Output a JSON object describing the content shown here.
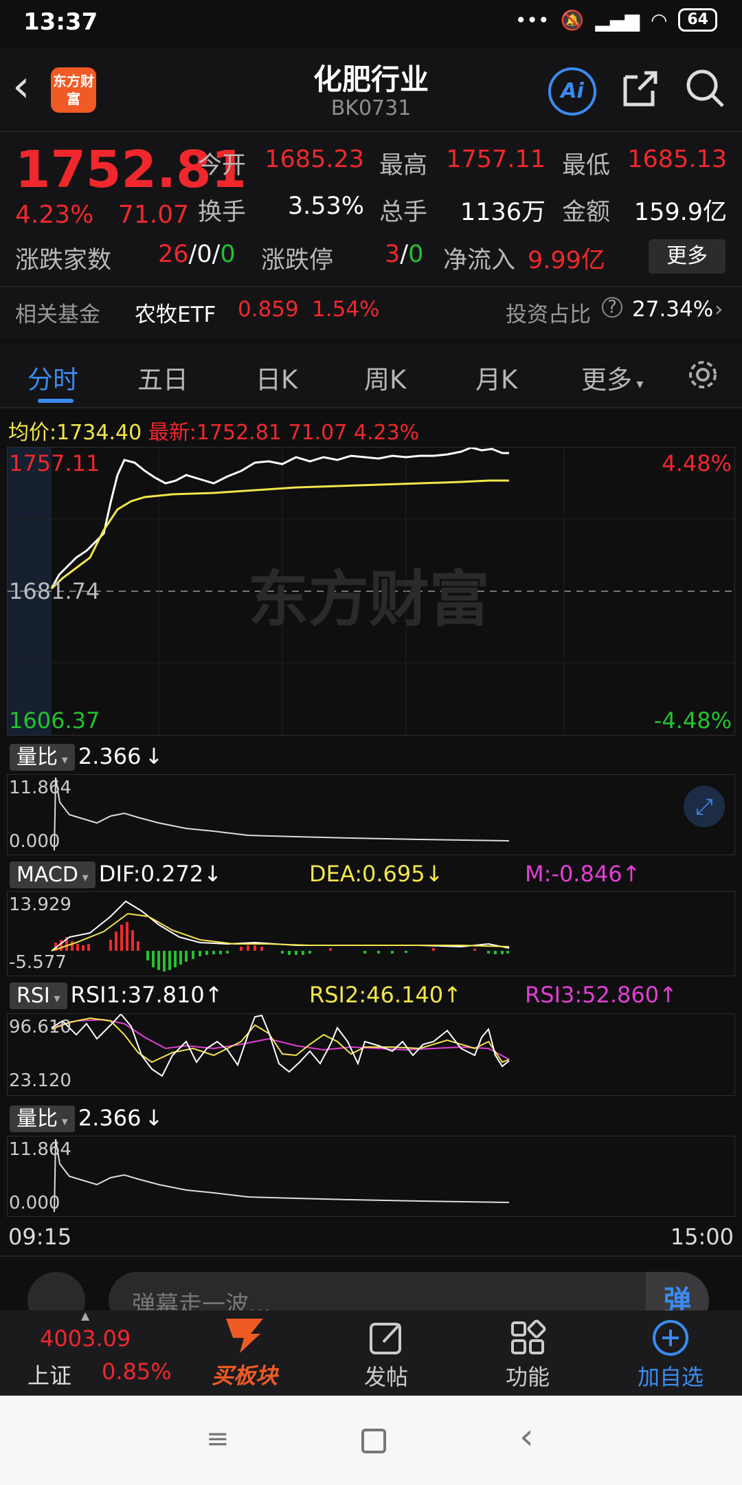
{
  "status": {
    "time": "13:37",
    "battery": "64"
  },
  "header": {
    "title": "化肥行业",
    "code": "BK0731",
    "ai_label": "Ai",
    "logo_text": "东方财富"
  },
  "quote": {
    "price": "1752.81",
    "pct": "4.23%",
    "chg": "71.07",
    "open_label": "今开",
    "open": "1685.23",
    "high_label": "最高",
    "high": "1757.11",
    "low_label": "最低",
    "low": "1685.13",
    "turnover_label": "换手",
    "turnover": "3.53%",
    "volume_label": "总手",
    "volume": "1136万",
    "amount_label": "金额",
    "amount": "159.9亿",
    "updown_label": "涨跌家数",
    "up": "26",
    "flat": "0",
    "down": "0",
    "limit_label": "涨跌停",
    "limit_up": "3",
    "limit_down": "0",
    "inflow_label": "净流入",
    "inflow": "9.99亿",
    "more": "更多"
  },
  "fund": {
    "label": "相关基金",
    "name": "农牧ETF",
    "price": "0.859",
    "pct": "1.54%",
    "ratio_label": "投资占比",
    "ratio": "27.34%"
  },
  "tabs": [
    "分时",
    "五日",
    "日K",
    "周K",
    "月K",
    "更多"
  ],
  "info": {
    "avg_label": "均价:",
    "avg": "1734.40",
    "latest_label": "最新:",
    "latest": "1752.81",
    "chg": "71.07",
    "pct": "4.23%"
  },
  "main_chart": {
    "top": "1757.11",
    "mid": "1681.74",
    "bottom": "1606.37",
    "top_pct": "4.48%",
    "bottom_pct": "-4.48%",
    "watermark": "东方财富"
  },
  "lb1": {
    "name": "量比",
    "value": "2.366",
    "arrow": "↓",
    "max": "11.864",
    "min": "0.000"
  },
  "macd": {
    "name": "MACD",
    "dif": "DIF:0.272",
    "dif_arrow": "↓",
    "dea": "DEA:0.695",
    "dea_arrow": "↓",
    "m": "M:-0.846",
    "m_arrow": "↑",
    "max": "13.929",
    "min": "-5.577"
  },
  "rsi": {
    "name": "RSI",
    "rsi1": "RSI1:37.810",
    "rsi1_arrow": "↑",
    "rsi2": "RSI2:46.140",
    "rsi2_arrow": "↑",
    "rsi3": "RSI3:52.860",
    "rsi3_arrow": "↑",
    "max": "96.610",
    "min": "23.120"
  },
  "lb2": {
    "name": "量比",
    "value": "2.366",
    "arrow": "↓",
    "max": "11.864",
    "min": "0.000"
  },
  "axis": {
    "start": "09:15",
    "end": "15:00"
  },
  "comment": {
    "placeholder": "弹幕走一波...",
    "btn": "弹"
  },
  "nav": {
    "index_value": "4003.09",
    "index_name": "上证",
    "index_pct": "0.85%",
    "buy": "买板块",
    "post": "发帖",
    "func": "功能",
    "add": "加自选"
  },
  "colors": {
    "up": "#f0282d",
    "down": "#22c32e",
    "accent": "#3b8bf0"
  }
}
